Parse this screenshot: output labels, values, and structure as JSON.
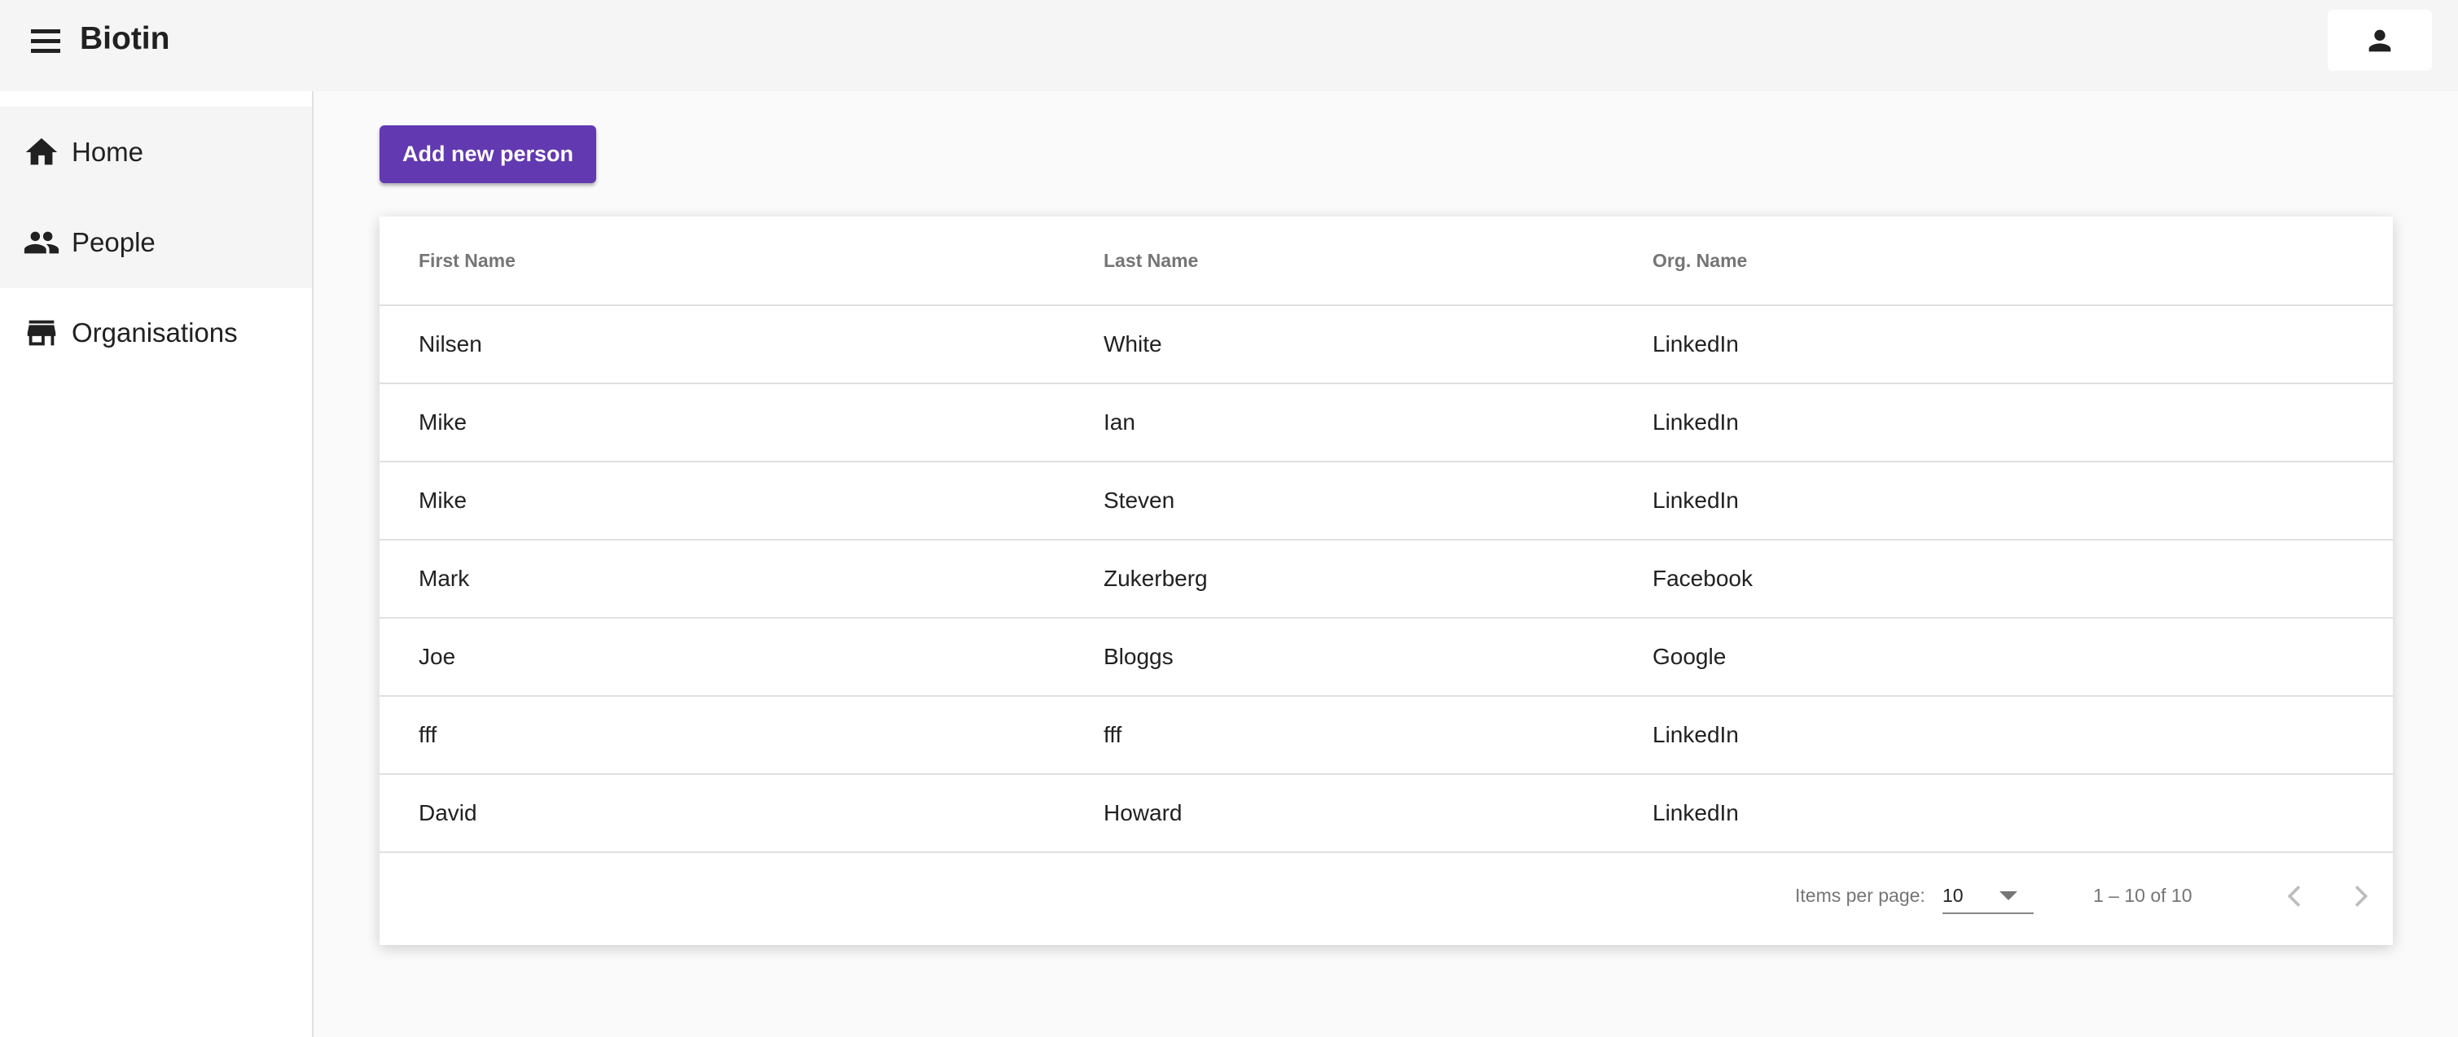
{
  "app": {
    "title": "Biotin"
  },
  "sidebar": {
    "items": [
      {
        "label": "Home",
        "icon": "home-icon"
      },
      {
        "label": "People",
        "icon": "people-icon"
      },
      {
        "label": "Organisations",
        "icon": "store-icon"
      }
    ]
  },
  "toolbar": {
    "add_label": "Add new person"
  },
  "table": {
    "columns": [
      "First Name",
      "Last Name",
      "Org. Name"
    ],
    "rows": [
      [
        "Nilsen",
        "White",
        "LinkedIn"
      ],
      [
        "Mike",
        "Ian",
        "LinkedIn"
      ],
      [
        "Mike",
        "Steven",
        "LinkedIn"
      ],
      [
        "Mark",
        "Zukerberg",
        "Facebook"
      ],
      [
        "Joe",
        "Bloggs",
        "Google"
      ],
      [
        "fff",
        "fff",
        "LinkedIn"
      ],
      [
        "David",
        "Howard",
        "LinkedIn"
      ]
    ]
  },
  "paginator": {
    "items_label": "Items per page:",
    "page_size": "10",
    "range": "1 – 10 of 10"
  },
  "colors": {
    "accent": "#6239b0"
  }
}
